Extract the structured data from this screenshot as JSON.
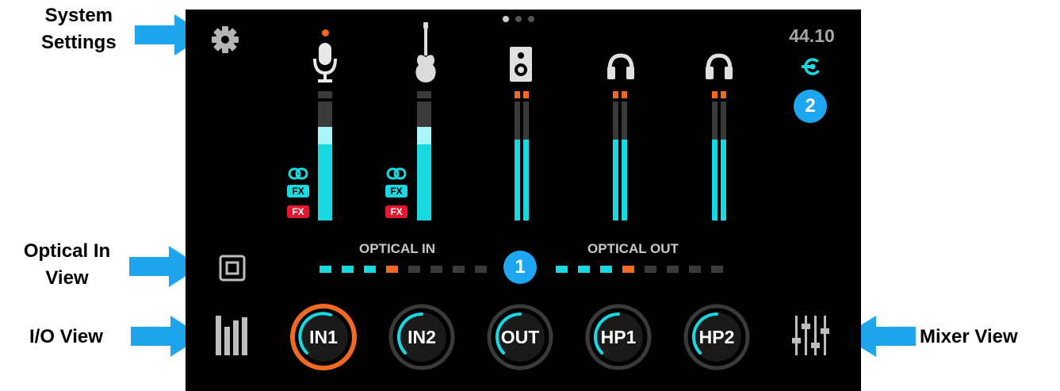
{
  "callouts": {
    "system_settings": [
      "System",
      "Settings"
    ],
    "optical_in_view": [
      "Optical In",
      "View"
    ],
    "io_view": "I/O View",
    "mixer_view": "Mixer View"
  },
  "screen": {
    "page_dots": 3,
    "active_page": 1,
    "sample_rate": "44.10",
    "badge_top": "2",
    "badge_center": "1",
    "channels": [
      {
        "name": "mic-input",
        "icon": "microphone-icon",
        "level": 0.7,
        "tags": [
          "link",
          "FX",
          "FX"
        ],
        "record_dot": true
      },
      {
        "name": "guitar-input",
        "icon": "guitar-icon",
        "level": 0.7,
        "tags": [
          "link",
          "FX",
          "FX"
        ],
        "record_dot": false
      },
      {
        "name": "speaker-output",
        "icon": "speaker-icon",
        "level": 0.65,
        "stereo": true
      },
      {
        "name": "headphone-1",
        "icon": "headphones-icon",
        "level": 0.65,
        "stereo": true
      },
      {
        "name": "headphone-2",
        "icon": "headphones-icon",
        "level": 0.65,
        "stereo": true
      }
    ],
    "optical_in_label": "OPTICAL IN",
    "optical_out_label": "OPTICAL OUT",
    "knobs": [
      "IN1",
      "IN2",
      "OUT",
      "HP1",
      "HP2"
    ],
    "selected_knob": "IN1",
    "colors": {
      "accent": "#18d9e2",
      "orange": "#f26a21",
      "blue": "#1fa6f0",
      "red": "#e8152f"
    }
  }
}
